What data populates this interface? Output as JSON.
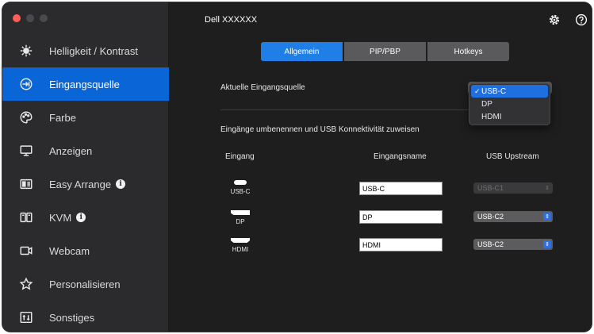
{
  "window": {
    "title": "Dell XXXXXX"
  },
  "sidebar": {
    "items": [
      {
        "label": "Helligkeit / Kontrast",
        "icon": "brightness-icon"
      },
      {
        "label": "Eingangsquelle",
        "icon": "input-source-icon",
        "active": true
      },
      {
        "label": "Farbe",
        "icon": "palette-icon"
      },
      {
        "label": "Anzeigen",
        "icon": "display-icon"
      },
      {
        "label": "Easy Arrange",
        "icon": "easy-arrange-icon",
        "info": "i"
      },
      {
        "label": "KVM",
        "icon": "kvm-icon",
        "info": "i"
      },
      {
        "label": "Webcam",
        "icon": "webcam-icon"
      },
      {
        "label": "Personalisieren",
        "icon": "star-icon"
      },
      {
        "label": "Sonstiges",
        "icon": "others-icon"
      }
    ]
  },
  "tabs": [
    {
      "label": "Allgemein",
      "active": true
    },
    {
      "label": "PIP/PBP"
    },
    {
      "label": "Hotkeys"
    }
  ],
  "current_input": {
    "label": "Aktuelle Eingangsquelle",
    "options": [
      "USB-C",
      "DP",
      "HDMI"
    ],
    "selected": "USB-C",
    "check": "✓"
  },
  "rename_section": {
    "heading": "Eingänge umbenennen und USB Konnektivität zuweisen",
    "columns": [
      "Eingang",
      "Eingangsname",
      "USB Upstream"
    ],
    "rows": [
      {
        "port": "USB-C",
        "name": "USB-C",
        "upstream": "USB-C1",
        "upstream_disabled": true
      },
      {
        "port": "DP",
        "name": "DP",
        "upstream": "USB-C2"
      },
      {
        "port": "HDMI",
        "name": "HDMI",
        "upstream": "USB-C2"
      }
    ]
  },
  "colors": {
    "accent": "#0a66d6",
    "sidebar_bg": "#2b2b2d",
    "main_bg": "#1e1e1e"
  }
}
